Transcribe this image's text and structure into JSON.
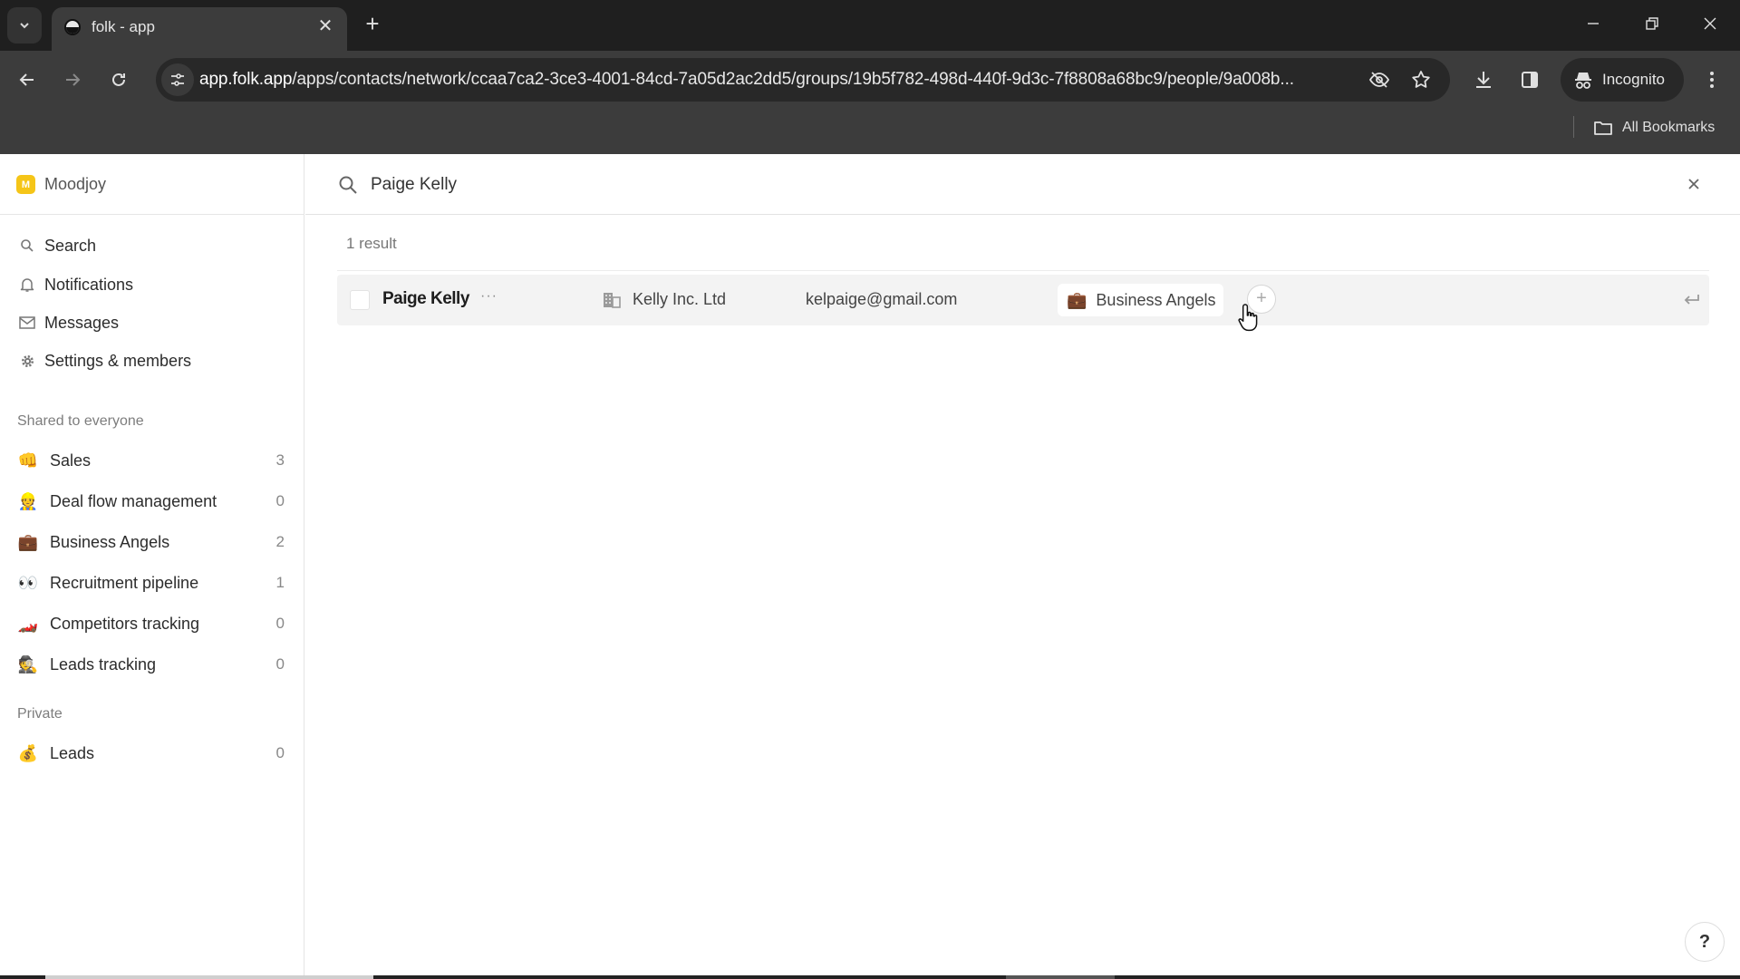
{
  "browser": {
    "tab": {
      "title": "folk - app"
    },
    "url": {
      "host": "app.folk.app",
      "path": "/apps/contacts/network/ccaa7ca2-3ce3-4001-84cd-7a05d2ac2dd5/groups/19b5f782-498d-440f-9d3c-7f8808a68bc9/people/9a008b..."
    },
    "incognito_label": "Incognito",
    "bookmarks_label": "All Bookmarks"
  },
  "sidebar": {
    "workspace": {
      "initial": "M",
      "name": "Moodjoy",
      "color": "#f5c518"
    },
    "nav": [
      {
        "label": "Search",
        "icon": "search-icon"
      },
      {
        "label": "Notifications",
        "icon": "bell-icon"
      },
      {
        "label": "Messages",
        "icon": "mail-icon"
      },
      {
        "label": "Settings & members",
        "icon": "gear-icon"
      }
    ],
    "shared_label": "Shared to everyone",
    "shared_groups": [
      {
        "emoji": "👊",
        "label": "Sales",
        "count": "3"
      },
      {
        "emoji": "👷",
        "label": "Deal flow management",
        "count": "0"
      },
      {
        "emoji": "💼",
        "label": "Business Angels",
        "count": "2"
      },
      {
        "emoji": "👀",
        "label": "Recruitment pipeline",
        "count": "1"
      },
      {
        "emoji": "🏎️",
        "label": "Competitors tracking",
        "count": "0"
      },
      {
        "emoji": "🕵️",
        "label": "Leads tracking",
        "count": "0"
      }
    ],
    "private_label": "Private",
    "private_groups": [
      {
        "emoji": "💰",
        "label": "Leads",
        "count": "0"
      }
    ]
  },
  "search": {
    "value": "Paige Kelly",
    "result_count": "1 result",
    "results": [
      {
        "name": "Paige Kelly",
        "more": "···",
        "company": "Kelly Inc. Ltd",
        "email": "kelpaige@gmail.com",
        "group": {
          "emoji": "💼",
          "label": "Business Angels"
        },
        "add_label": "+"
      }
    ]
  },
  "help_label": "?"
}
